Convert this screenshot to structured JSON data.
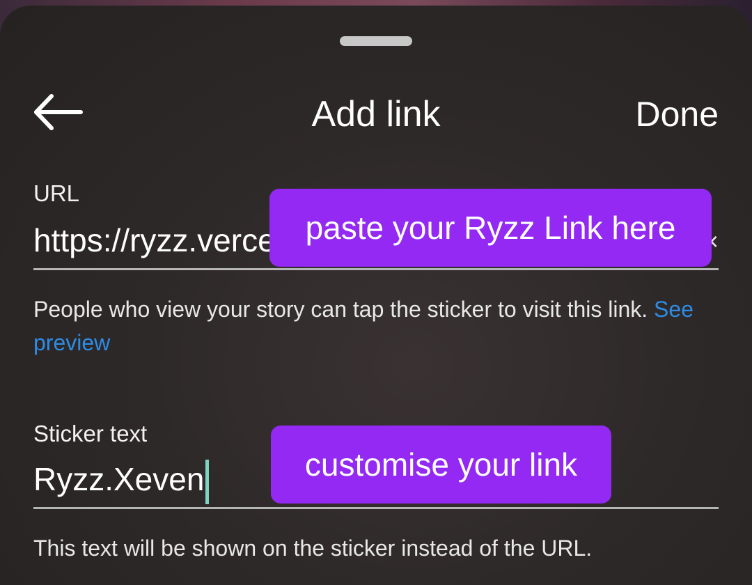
{
  "header": {
    "back_icon": "arrow-left-icon",
    "title": "Add link",
    "done_label": "Done"
  },
  "url_section": {
    "label": "URL",
    "value": "https://ryzz.vercel.app",
    "clear_icon": "close-icon",
    "clear_glyph": "×",
    "helper_text": "People who view your story can tap the sticker to visit this link.",
    "preview_link": "See preview"
  },
  "sticker_section": {
    "label": "Sticker text",
    "value": "Ryzz.Xeven",
    "helper_text": "This text will be shown on the sticker instead of the URL."
  },
  "annotations": {
    "paste_hint": "paste your Ryzz Link here",
    "customise_hint": "customise your link",
    "color": "#9329f2"
  },
  "colors": {
    "sheet": "#2e2929",
    "link": "#2e8ce6",
    "cursor": "#7fd3c2"
  }
}
